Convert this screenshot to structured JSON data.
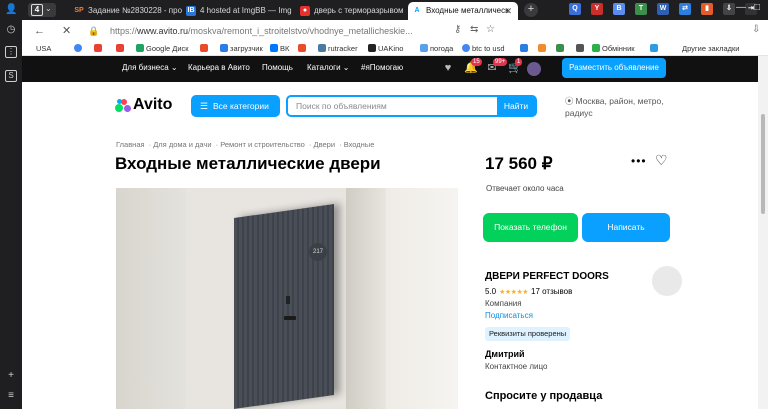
{
  "browser": {
    "tab_count": "4",
    "tabs": [
      {
        "label": "Задание №2830228 - про",
        "fav": "SP",
        "fav_color": "#1f1f22"
      },
      {
        "label": "4 hosted at ImgBB — Img",
        "fav": "IB",
        "fav_color": "#2b74d8"
      },
      {
        "label": "дверь с терморазрывом",
        "fav": "●",
        "fav_color": "#e5322d"
      },
      {
        "label": "Входные металлическ",
        "fav": "A",
        "fav_color": "#0aa0ff"
      }
    ],
    "url_prefix": "https://",
    "url_host": "www.avito.ru",
    "url_path": "/moskva/remont_i_stroitelstvo/vhodnye_metallicheskie..."
  },
  "bookmarks": [
    {
      "label": "USA",
      "color": "#ffffff"
    },
    {
      "label": "",
      "color": "#4285f4"
    },
    {
      "label": "",
      "color": "#e94235"
    },
    {
      "label": "Google Диск",
      "color": "#1fa463"
    },
    {
      "label": "загрузчик",
      "color": "#2d7be8"
    },
    {
      "label": "ВК",
      "color": "#0077ff"
    },
    {
      "label": "",
      "color": "#ea4c2a"
    },
    {
      "label": "rutracker",
      "color": "#4b79a1"
    },
    {
      "label": "UAKino",
      "color": "#222222"
    },
    {
      "label": "погода",
      "color": "#5aa0e8"
    },
    {
      "label": "btc to usd",
      "color": "#4285f4"
    },
    {
      "label": "Обмінник",
      "color": "#2bb04a"
    },
    {
      "label": "Другие закладки",
      "color": "#f7c948"
    }
  ],
  "avito_nav": {
    "links": [
      "Для бизнеса",
      "Карьера в Авито",
      "Помощь",
      "Каталоги",
      "#яПомогаю"
    ],
    "badge_messages": "15",
    "badge_notifications": "99+",
    "badge_cart": "1",
    "post_button": "Разместить объявление"
  },
  "search": {
    "logo": "Avito",
    "categories_button": "Все категории",
    "placeholder": "Поиск по объявлениям",
    "find_button": "Найти",
    "location": "Москва, район, метро, радиус"
  },
  "breadcrumbs": [
    "Главная",
    "Для дома и дачи",
    "Ремонт и строительство",
    "Двери",
    "Входные"
  ],
  "listing": {
    "title": "Входные металлические двери",
    "price": "17 560 ₽",
    "reply_time": "Отвечает около часа",
    "show_phone": "Показать телефон",
    "write": "Написать",
    "photo_door_number": "217"
  },
  "seller": {
    "name": "ДВЕРИ PERFECT DOORS",
    "rating": "5.0",
    "reviews": "17 отзывов",
    "type": "Компания",
    "subscribe": "Подписаться",
    "verified": "Реквизиты проверены",
    "contact_name": "Дмитрий",
    "contact_role": "Контактное лицо"
  },
  "ask_seller": "Спросите у продавца"
}
